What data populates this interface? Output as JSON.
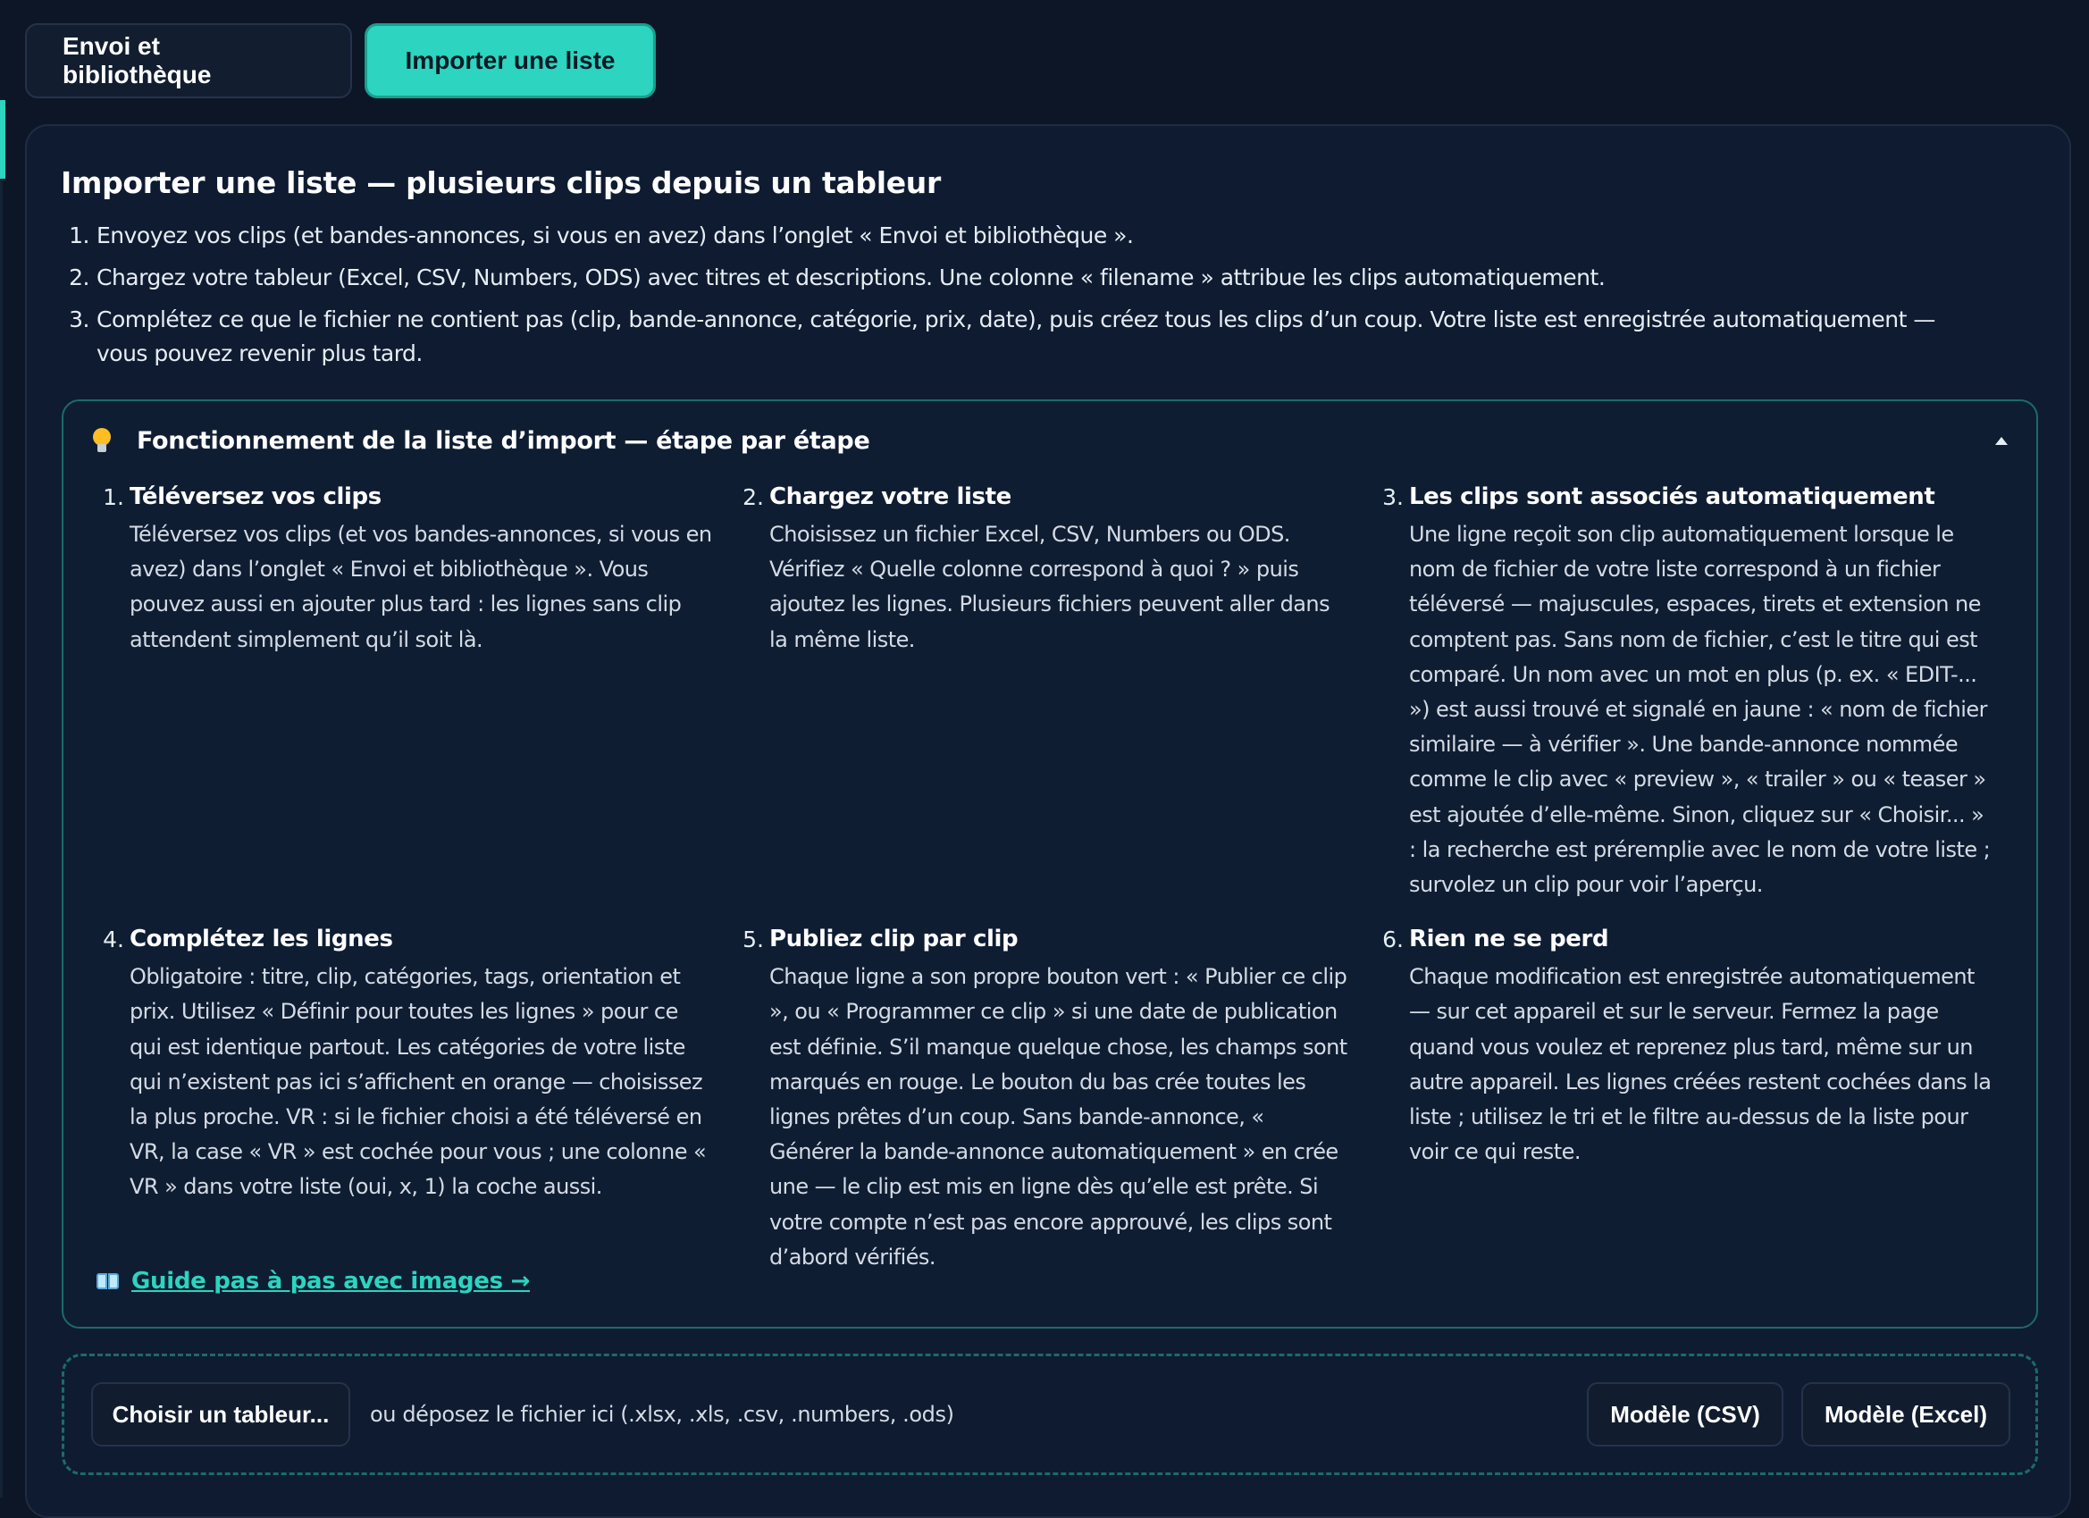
{
  "tabs": [
    {
      "label": "Envoi et bibliothèque",
      "active": false
    },
    {
      "label": "Importer une liste",
      "active": true
    }
  ],
  "panel": {
    "title": "Importer une liste — plusieurs clips depuis un tableur",
    "intro": [
      {
        "num": "1.",
        "text": "Envoyez vos clips (et bandes-annonces, si vous en avez) dans l’onglet « Envoi et bibliothèque »."
      },
      {
        "num": "2.",
        "text": "Chargez votre tableur (Excel, CSV, Numbers, ODS) avec titres et descriptions. Une colonne « filename » attribue les clips automatiquement."
      },
      {
        "num": "3.",
        "text": "Complétez ce que le fichier ne contient pas (clip, bande-annonce, catégorie, prix, date), puis créez tous les clips d’un coup. Votre liste est enregistrée automatiquement — vous pouvez revenir plus tard."
      }
    ]
  },
  "howto": {
    "icon": "lightbulb-icon",
    "title": "Fonctionnement de la liste d’import — étape par étape",
    "expanded": true,
    "steps": [
      {
        "num": "1.",
        "title": "Téléversez vos clips",
        "text": "Téléversez vos clips (et vos bandes-annonces, si vous en avez) dans l’onglet « Envoi et bibliothèque ». Vous pouvez aussi en ajouter plus tard : les lignes sans clip attendent simplement qu’il soit là."
      },
      {
        "num": "2.",
        "title": "Chargez votre liste",
        "text": "Choisissez un fichier Excel, CSV, Numbers ou ODS. Vérifiez « Quelle colonne correspond à quoi ? » puis ajoutez les lignes. Plusieurs fichiers peuvent aller dans la même liste."
      },
      {
        "num": "3.",
        "title": "Les clips sont associés automatiquement",
        "text": "Une ligne reçoit son clip automatiquement lorsque le nom de fichier de votre liste correspond à un fichier téléversé — majuscules, espaces, tirets et extension ne comptent pas. Sans nom de fichier, c’est le titre qui est comparé. Un nom avec un mot en plus (p. ex. « EDIT-... ») est aussi trouvé et signalé en jaune : « nom de fichier similaire — à vérifier ». Une bande-annonce nommée comme le clip avec « preview », « trailer » ou « teaser » est ajoutée d’elle-même. Sinon, cliquez sur « Choisir... » : la recherche est préremplie avec le nom de votre liste ; survolez un clip pour voir l’aperçu."
      },
      {
        "num": "4.",
        "title": "Complétez les lignes",
        "text": "Obligatoire : titre, clip, catégories, tags, orientation et prix. Utilisez « Définir pour toutes les lignes » pour ce qui est identique partout. Les catégories de votre liste qui n’existent pas ici s’affichent en orange — choisissez la plus proche. VR : si le fichier choisi a été téléversé en VR, la case « VR » est cochée pour vous ; une colonne « VR » dans votre liste (oui, x, 1) la coche aussi."
      },
      {
        "num": "5.",
        "title": "Publiez clip par clip",
        "text": "Chaque ligne a son propre bouton vert : « Publier ce clip », ou « Programmer ce clip » si une date de publication est définie. S’il manque quelque chose, les champs sont marqués en rouge. Le bouton du bas crée toutes les lignes prêtes d’un coup. Sans bande-annonce, « Générer la bande-annonce automatiquement » en crée une — le clip est mis en ligne dès qu’elle est prête. Si votre compte n’est pas encore approuvé, les clips sont d’abord vérifiés."
      },
      {
        "num": "6.",
        "title": "Rien ne se perd",
        "text": "Chaque modification est enregistrée automatiquement — sur cet appareil et sur le serveur. Fermez la page quand vous voulez et reprenez plus tard, même sur un autre appareil. Les lignes créées restent cochées dans la liste ; utilisez le tri et le filtre au-dessus de la liste pour voir ce qui reste."
      }
    ],
    "guide_link": {
      "icon": "book-icon",
      "label": "Guide pas à pas avec images →"
    }
  },
  "dropzone": {
    "choose_label": "Choisir un tableur...",
    "hint": "ou déposez le fichier ici (.xlsx, .xls, .csv, .numbers, .ods)",
    "template_csv_label": "Modèle (CSV)",
    "template_excel_label": "Modèle (Excel)"
  },
  "colors": {
    "background": "#0c1626",
    "panel": "#0f1b31",
    "accent": "#2dd4bf",
    "accent_border": "#1b6b69",
    "text": "#e6edf3"
  }
}
